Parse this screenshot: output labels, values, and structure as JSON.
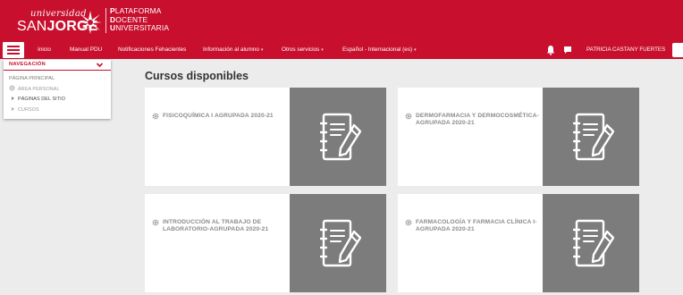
{
  "header": {
    "logo_universidad": "universidad",
    "logo_san": "SAN",
    "logo_jorge": "JORGE",
    "platform": [
      {
        "first": "P",
        "rest": "LATAFORMA"
      },
      {
        "first": "D",
        "rest": "OCENTE"
      },
      {
        "first": "U",
        "rest": "NIVERSITARIA"
      }
    ]
  },
  "nav": {
    "items": [
      {
        "label": "Inicio",
        "dropdown": false
      },
      {
        "label": "Manual PDU",
        "dropdown": false
      },
      {
        "label": "Notificaciones Fehacientes",
        "dropdown": false
      },
      {
        "label": "Información al alumno",
        "dropdown": true
      },
      {
        "label": "Otros servicios",
        "dropdown": true
      },
      {
        "label": "Español - Internacional (es)",
        "dropdown": true
      }
    ],
    "user_name": "PATRICIA CASTANY FUERTES",
    "icons": [
      "menu-icon",
      "bell-icon",
      "chat-icon",
      "search-icon"
    ]
  },
  "sidebar": {
    "title": "NAVEGACIÓN",
    "items": [
      {
        "label": "PÁGINA PRINCIPAL",
        "icon": "none"
      },
      {
        "label": "ÁREA PERSONAL",
        "icon": "gear-icon"
      },
      {
        "label": "PÁGINAS DEL SITIO",
        "icon": "triangle-icon"
      },
      {
        "label": "CURSOS",
        "icon": "triangle-icon"
      }
    ]
  },
  "main": {
    "title": "Cursos disponibles",
    "courses": [
      {
        "name": "FISICOQUÍMICA I AGRUPADA 2020-21"
      },
      {
        "name": "DERMOFARMACIA Y DERMOCOSMÉTICA-AGRUPADA 2020-21"
      },
      {
        "name": "INTRODUCCIÓN AL TRABAJO DE LABORATORIO-AGRUPADA 2020-21"
      },
      {
        "name": "FARMACOLOGÍA Y FARMACIA CLÍNICA I-AGRUPADA 2020-21"
      }
    ]
  },
  "colors": {
    "brand_red": "#c8102e",
    "background": "#ececec",
    "card_image_gray": "#7c7c7c"
  }
}
